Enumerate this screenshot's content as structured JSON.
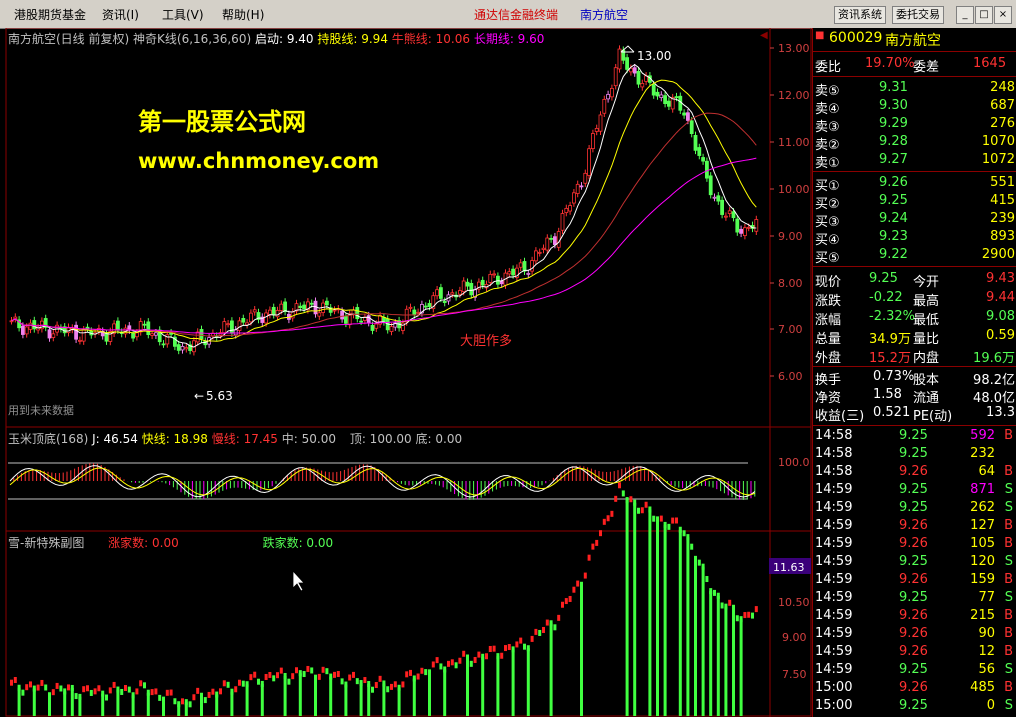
{
  "menu": {
    "items": [
      "港股期货基金",
      "资讯(I)",
      "工具(V)",
      "帮助(H)"
    ],
    "center_title": "通达信金融终端",
    "center_stock": "南方航空",
    "btn_news": "资讯系统",
    "btn_trade": "委托交易",
    "win_min": "_",
    "win_max": "□",
    "win_close": "×"
  },
  "main_chart": {
    "title": "南方航空(日线 前复权)",
    "indicator": "神奇K线(6,16,36,60)",
    "start_label": "启动: 9.40",
    "hold_label": "持股线: 9.94",
    "bull_label": "牛熊线: 10.06",
    "long_label": "长期线: 9.60",
    "watermark_title": "第一股票公式网",
    "watermark_url": "www.chnmoney.com",
    "peak_label": "13.00",
    "low_label": "5.63",
    "annotation": "大胆作多",
    "future_data": "用到未来数据",
    "y_ticks": [
      "13.00",
      "12.00",
      "11.00",
      "10.00",
      "9.00",
      "8.00",
      "7.00",
      "6.00"
    ]
  },
  "osc_chart": {
    "title": "玉米顶底(168)",
    "j": "J: 46.54",
    "fast": "快线: 18.98",
    "slow": "慢线: 17.45",
    "mid": "中: 50.00",
    "top": "顶: 100.00",
    "bottom": "底: 0.00",
    "y_tick": "100.0"
  },
  "sub_chart": {
    "title": "雪-新特殊副图",
    "up_count": "涨家数: 0.00",
    "down_count": "跌家数: 0.00",
    "price_badge": "11.63",
    "y_ticks": [
      "10.50",
      "9.00",
      "7.50"
    ]
  },
  "quote": {
    "code": "600029",
    "name": "南方航空",
    "ratio_label": "委比",
    "ratio": "19.70%",
    "diff_label": "委差",
    "diff": "1645",
    "sells": [
      {
        "label": "卖⑤",
        "price": "9.31",
        "vol": "248"
      },
      {
        "label": "卖④",
        "price": "9.30",
        "vol": "687"
      },
      {
        "label": "卖③",
        "price": "9.29",
        "vol": "276"
      },
      {
        "label": "卖②",
        "price": "9.28",
        "vol": "1070"
      },
      {
        "label": "卖①",
        "price": "9.27",
        "vol": "1072"
      }
    ],
    "buys": [
      {
        "label": "买①",
        "price": "9.26",
        "vol": "551"
      },
      {
        "label": "买②",
        "price": "9.25",
        "vol": "415"
      },
      {
        "label": "买③",
        "price": "9.24",
        "vol": "239"
      },
      {
        "label": "买④",
        "price": "9.23",
        "vol": "893"
      },
      {
        "label": "买⑤",
        "price": "9.22",
        "vol": "2900"
      }
    ],
    "stats": [
      {
        "l1": "现价",
        "v1": "9.25",
        "l2": "今开",
        "v2": "9.43"
      },
      {
        "l1": "涨跌",
        "v1": "-0.22",
        "l2": "最高",
        "v2": "9.44"
      },
      {
        "l1": "涨幅",
        "v1": "-2.32%",
        "l2": "最低",
        "v2": "9.08"
      },
      {
        "l1": "总量",
        "v1": "34.9万",
        "l2": "量比",
        "v2": "0.59"
      },
      {
        "l1": "外盘",
        "v1": "15.2万",
        "l2": "内盘",
        "v2": "19.6万"
      }
    ],
    "fund": [
      {
        "l1": "换手",
        "v1": "0.73%",
        "l2": "股本",
        "v2": "98.2亿"
      },
      {
        "l1": "净资",
        "v1": "1.58",
        "l2": "流通",
        "v2": "48.0亿"
      },
      {
        "l1": "收益(三)",
        "v1": "0.521",
        "l2": "PE(动)",
        "v2": "13.3"
      }
    ],
    "ticks": [
      {
        "t": "14:58",
        "p": "9.25",
        "v": "592",
        "d": "B"
      },
      {
        "t": "14:58",
        "p": "9.25",
        "v": "232",
        "d": ""
      },
      {
        "t": "14:58",
        "p": "9.26",
        "v": "64",
        "d": "B"
      },
      {
        "t": "14:59",
        "p": "9.25",
        "v": "871",
        "d": "S"
      },
      {
        "t": "14:59",
        "p": "9.25",
        "v": "262",
        "d": "S"
      },
      {
        "t": "14:59",
        "p": "9.26",
        "v": "127",
        "d": "B"
      },
      {
        "t": "14:59",
        "p": "9.26",
        "v": "105",
        "d": "B"
      },
      {
        "t": "14:59",
        "p": "9.25",
        "v": "120",
        "d": "S"
      },
      {
        "t": "14:59",
        "p": "9.26",
        "v": "159",
        "d": "B"
      },
      {
        "t": "14:59",
        "p": "9.25",
        "v": "77",
        "d": "S"
      },
      {
        "t": "14:59",
        "p": "9.26",
        "v": "215",
        "d": "B"
      },
      {
        "t": "14:59",
        "p": "9.26",
        "v": "90",
        "d": "B"
      },
      {
        "t": "14:59",
        "p": "9.26",
        "v": "12",
        "d": "B"
      },
      {
        "t": "14:59",
        "p": "9.25",
        "v": "56",
        "d": "S"
      },
      {
        "t": "15:00",
        "p": "9.26",
        "v": "485",
        "d": "B"
      },
      {
        "t": "15:00",
        "p": "9.25",
        "v": "0",
        "d": "S"
      }
    ]
  },
  "colors": {
    "up": "#ff3232",
    "down": "#54ff54",
    "yellow": "#ffff00",
    "cyan": "#00ffff",
    "magenta": "#ff00ff",
    "grid": "#8b0000"
  }
}
